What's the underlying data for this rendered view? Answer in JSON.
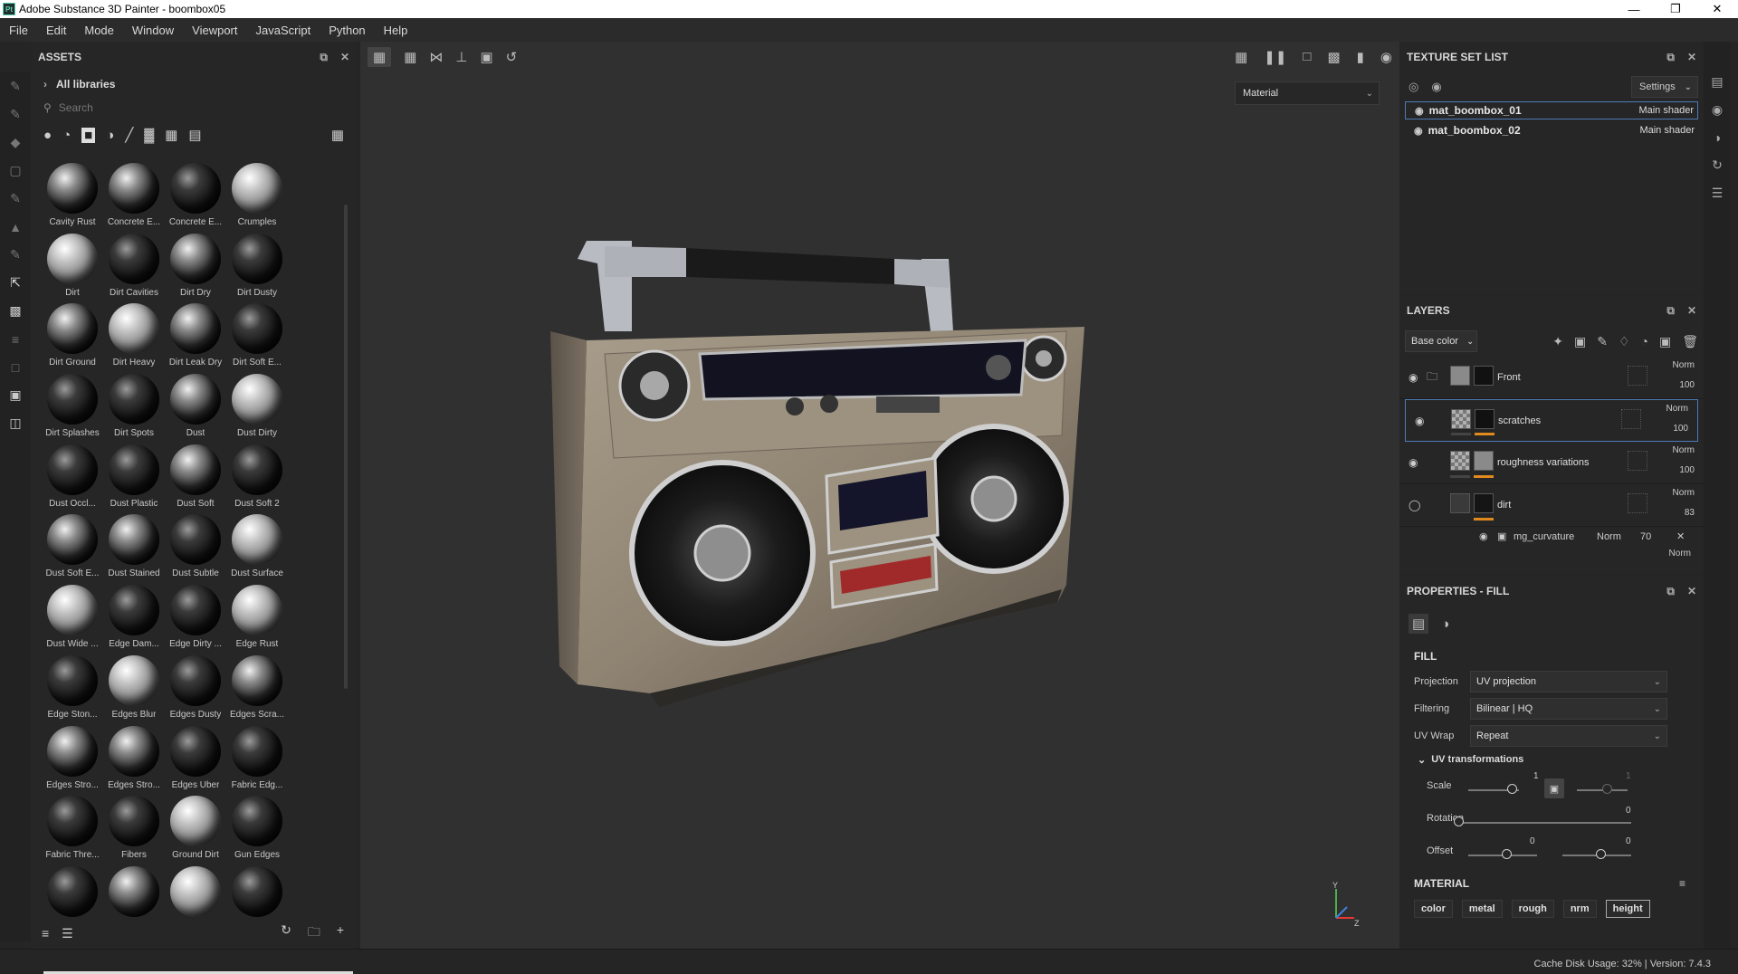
{
  "window": {
    "title": "Adobe Substance 3D Painter - boombox05",
    "icon_text": "Pt"
  },
  "menu": [
    "File",
    "Edit",
    "Mode",
    "Window",
    "Viewport",
    "JavaScript",
    "Python",
    "Help"
  ],
  "assets": {
    "title": "ASSETS",
    "library": "All libraries",
    "search_placeholder": "Search",
    "items": [
      {
        "label": "Cavity Rust",
        "tone": "mid"
      },
      {
        "label": "Concrete E...",
        "tone": "mid"
      },
      {
        "label": "Concrete E...",
        "tone": "dark"
      },
      {
        "label": "Crumples",
        "tone": "light"
      },
      {
        "label": "Dirt",
        "tone": "light"
      },
      {
        "label": "Dirt Cavities",
        "tone": "dark"
      },
      {
        "label": "Dirt Dry",
        "tone": "mid"
      },
      {
        "label": "Dirt Dusty",
        "tone": "dark"
      },
      {
        "label": "Dirt Ground",
        "tone": "mid"
      },
      {
        "label": "Dirt Heavy",
        "tone": "light"
      },
      {
        "label": "Dirt Leak Dry",
        "tone": "mid"
      },
      {
        "label": "Dirt Soft E...",
        "tone": "dark"
      },
      {
        "label": "Dirt Splashes",
        "tone": "dark"
      },
      {
        "label": "Dirt Spots",
        "tone": "dark"
      },
      {
        "label": "Dust",
        "tone": "mid"
      },
      {
        "label": "Dust Dirty",
        "tone": "light"
      },
      {
        "label": "Dust Occl...",
        "tone": "dark"
      },
      {
        "label": "Dust Plastic",
        "tone": "dark"
      },
      {
        "label": "Dust Soft",
        "tone": "mid"
      },
      {
        "label": "Dust Soft 2",
        "tone": "dark"
      },
      {
        "label": "Dust Soft E...",
        "tone": "mid"
      },
      {
        "label": "Dust Stained",
        "tone": "mid"
      },
      {
        "label": "Dust Subtle",
        "tone": "dark"
      },
      {
        "label": "Dust Surface",
        "tone": "light"
      },
      {
        "label": "Dust Wide ...",
        "tone": "light"
      },
      {
        "label": "Edge Dam...",
        "tone": "dark"
      },
      {
        "label": "Edge Dirty ...",
        "tone": "dark"
      },
      {
        "label": "Edge Rust",
        "tone": "light"
      },
      {
        "label": "Edge Ston...",
        "tone": "dark"
      },
      {
        "label": "Edges Blur",
        "tone": "light"
      },
      {
        "label": "Edges Dusty",
        "tone": "dark"
      },
      {
        "label": "Edges Scra...",
        "tone": "mid"
      },
      {
        "label": "Edges Stro...",
        "tone": "mid"
      },
      {
        "label": "Edges Stro...",
        "tone": "mid"
      },
      {
        "label": "Edges Uber",
        "tone": "dark"
      },
      {
        "label": "Fabric Edg...",
        "tone": "dark"
      },
      {
        "label": "Fabric Thre...",
        "tone": "dark"
      },
      {
        "label": "Fibers",
        "tone": "dark"
      },
      {
        "label": "Ground Dirt",
        "tone": "light"
      },
      {
        "label": "Gun Edges",
        "tone": "dark"
      },
      {
        "label": "",
        "tone": "dark"
      },
      {
        "label": "",
        "tone": "mid"
      },
      {
        "label": "",
        "tone": "light"
      },
      {
        "label": "",
        "tone": "dark"
      }
    ]
  },
  "viewport": {
    "material_mode": "Material"
  },
  "texture_set_list": {
    "title": "TEXTURE SET LIST",
    "settings": "Settings",
    "sets": [
      {
        "name": "mat_boombox_01",
        "shader": "Main shader",
        "selected": true
      },
      {
        "name": "mat_boombox_02",
        "shader": "Main shader",
        "selected": false
      }
    ]
  },
  "layers": {
    "title": "LAYERS",
    "channel": "Base color",
    "items": [
      {
        "name": "Front",
        "blend": "Norm",
        "opacity": "100",
        "type": "folder"
      },
      {
        "name": "scratches",
        "blend": "Norm",
        "opacity": "100",
        "type": "fill",
        "selected": true
      },
      {
        "name": "roughness variations",
        "blend": "Norm",
        "opacity": "100",
        "type": "fill"
      },
      {
        "name": "dirt",
        "blend": "Norm",
        "opacity": "83",
        "type": "fill"
      }
    ],
    "sub": {
      "name": "mg_curvature",
      "blend": "Norm",
      "opacity": "70"
    },
    "partial_blend": "Norm"
  },
  "properties": {
    "title": "PROPERTIES - FILL",
    "section": "FILL",
    "projection_label": "Projection",
    "projection": "UV projection",
    "filtering_label": "Filtering",
    "filtering": "Bilinear | HQ",
    "uvwrap_label": "UV Wrap",
    "uvwrap": "Repeat",
    "uvt_label": "UV transformations",
    "scale_label": "Scale",
    "scale_value": "1",
    "scale_value2": "1",
    "rotation_label": "Rotation",
    "rotation_value": "0",
    "offset_label": "Offset",
    "offset_value_u": "0",
    "offset_value_v": "0",
    "material_label": "MATERIAL",
    "channels": [
      "color",
      "metal",
      "rough",
      "nrm",
      "height"
    ]
  },
  "status": {
    "cache": "Cache Disk Usage:   32% | Version: 7.4.3"
  }
}
